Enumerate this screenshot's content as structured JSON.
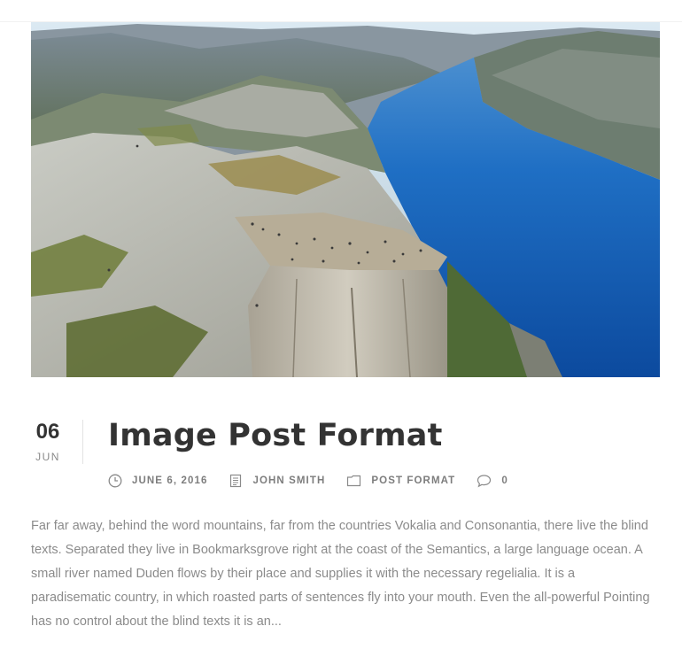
{
  "post": {
    "image_alt": "Aerial view of a clifftop over a blue fjord",
    "date": {
      "day": "06",
      "month": "JUN"
    },
    "title": "Image Post Format",
    "meta": {
      "date_text": "JUNE 6, 2016",
      "author": "JOHN SMITH",
      "category": "POST FORMAT",
      "comments": "0"
    },
    "excerpt": "Far far away, behind the word mountains, far from the countries Vokalia and Consonantia, there live the blind texts. Separated they live in Bookmarksgrove right at the coast of the Semantics, a large language ocean. A small river named Duden flows by their place and supplies it with the necessary regelialia. It is a paradisematic country, in which roasted parts of sentences fly into your mouth. Even the all-powerful Pointing has no control about the blind texts it is an..."
  },
  "icons": {
    "date": "clock-icon",
    "author": "book-icon",
    "category": "folder-icon",
    "comments": "comment-icon"
  },
  "colors": {
    "title": "#333333",
    "meta": "#7d7d7d",
    "excerpt": "#8b8b8b",
    "fjord": "#1560b8"
  }
}
